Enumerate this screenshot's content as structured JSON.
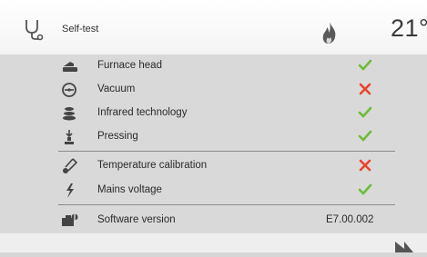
{
  "header": {
    "title": "Self-test",
    "temperature": "21°",
    "icons": {
      "left": "stethoscope-icon",
      "flame": "flame-icon"
    }
  },
  "tests": [
    {
      "label": "Furnace head",
      "icon": "furnace-head-icon",
      "status": "pass"
    },
    {
      "label": "Vacuum",
      "icon": "vacuum-icon",
      "status": "fail"
    },
    {
      "label": "Infrared technology",
      "icon": "infrared-icon",
      "status": "pass"
    },
    {
      "label": "Pressing",
      "icon": "pressing-icon",
      "status": "pass"
    },
    {
      "label": "Temperature calibration",
      "icon": "thermometer-icon",
      "status": "fail"
    },
    {
      "label": "Mains voltage",
      "icon": "lightning-icon",
      "status": "pass"
    }
  ],
  "software": {
    "label": "Software version",
    "value": "E7.00.002",
    "icon": "software-icon"
  },
  "colors": {
    "pass": "#6dbb3a",
    "fail": "#e8432c"
  }
}
